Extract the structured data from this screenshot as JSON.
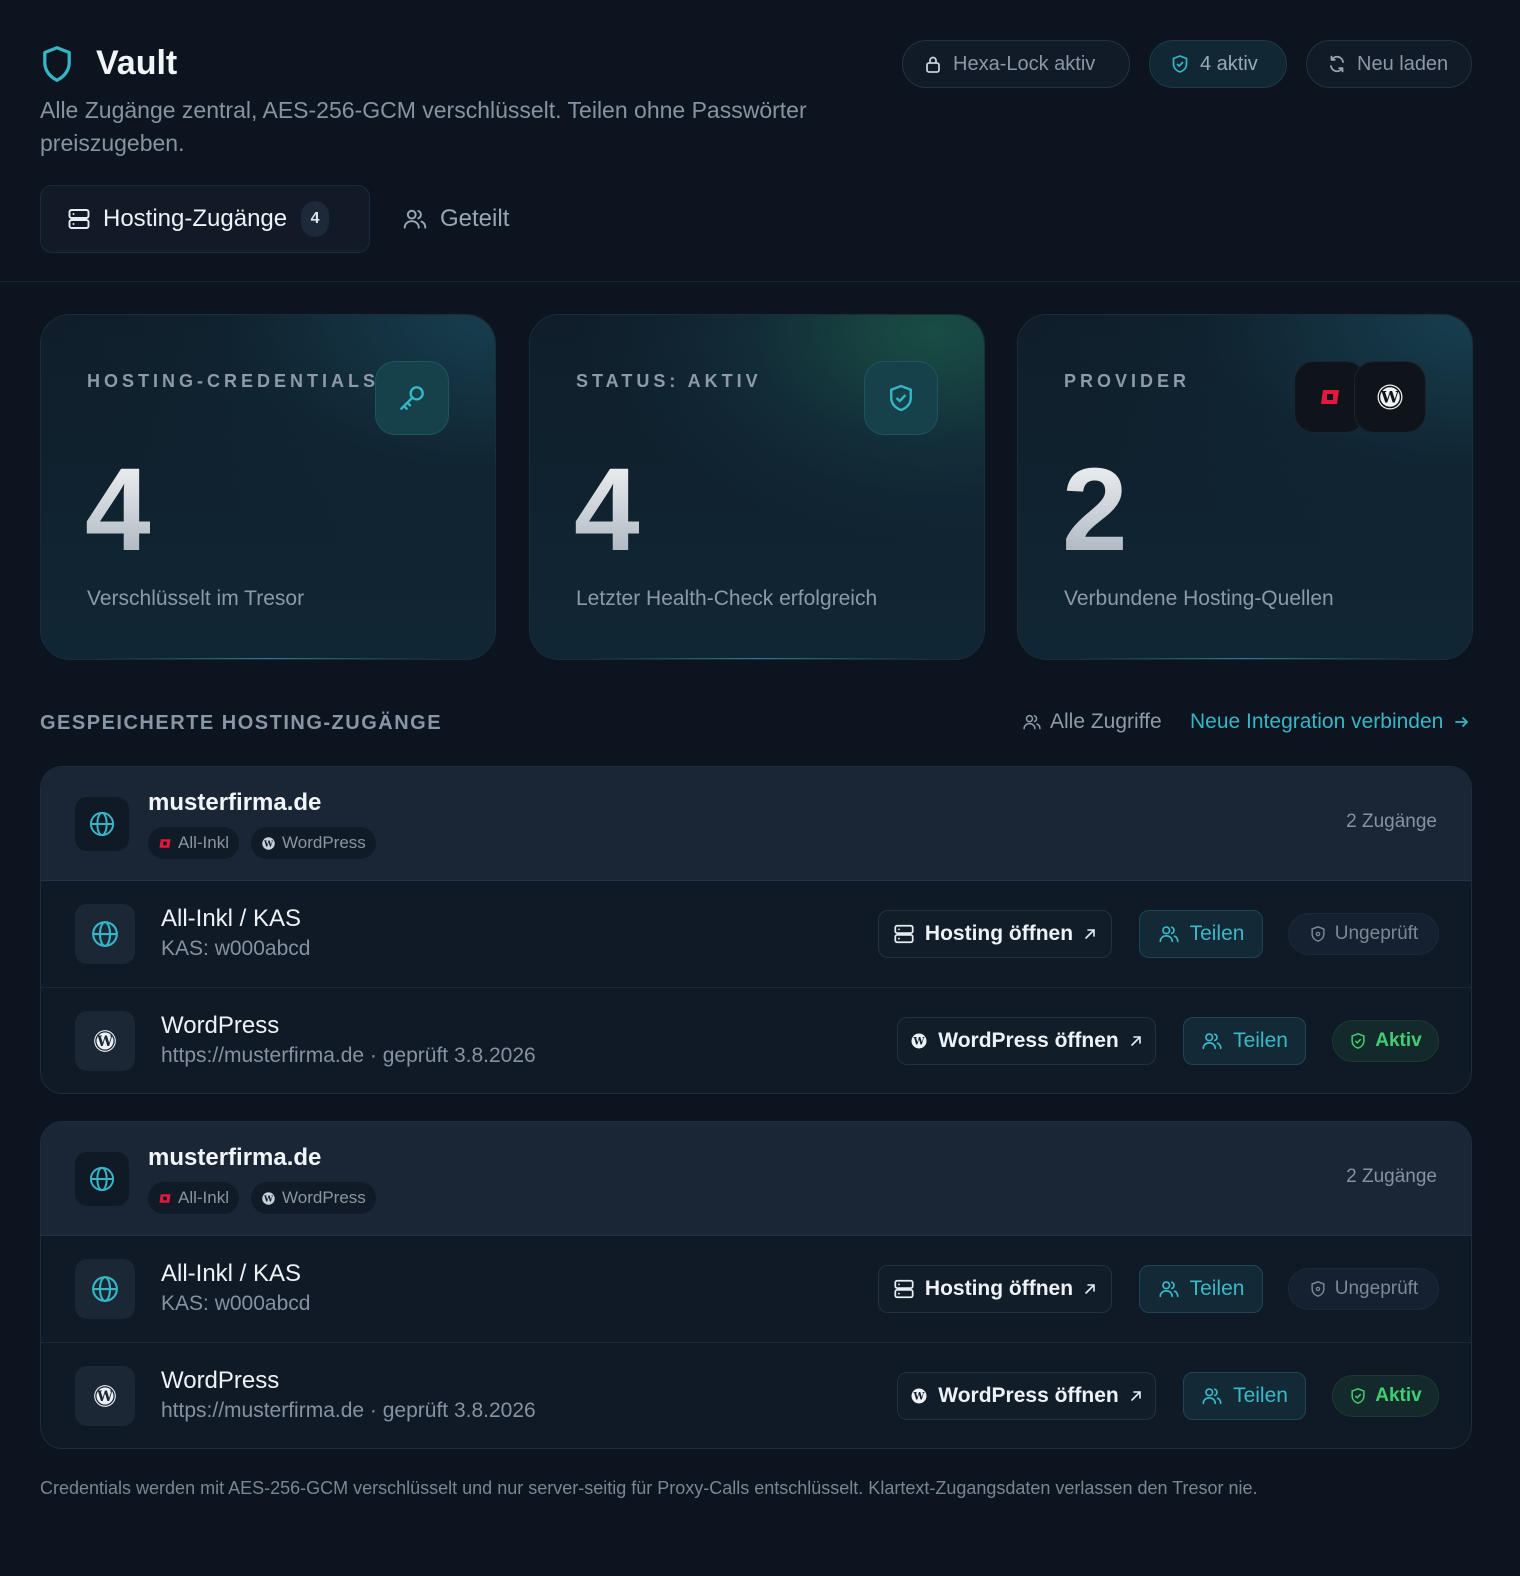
{
  "header": {
    "title": "Vault",
    "subtitle": "Alle Zugänge zentral, AES-256-GCM verschlüsselt. Teilen ohne Passwörter preiszugeben.",
    "hexa_lock_label": "Hexa-Lock aktiv",
    "active_label": "4 aktiv",
    "reload_label": "Neu laden"
  },
  "tabs": {
    "hosting_label": "Hosting-Zugänge",
    "hosting_count": "4",
    "shared_label": "Geteilt"
  },
  "stats": [
    {
      "label": "HOSTING-CREDENTIALS",
      "value": "4",
      "desc": "Verschlüsselt im Tresor"
    },
    {
      "label": "STATUS: AKTIV",
      "value": "4",
      "desc": "Letzter Health-Check erfolgreich"
    },
    {
      "label": "PROVIDER",
      "value": "2",
      "desc": "Verbundene Hosting-Quellen"
    }
  ],
  "section": {
    "title": "GESPEICHERTE HOSTING-ZUGÄNGE",
    "all_access_label": "Alle Zugriffe",
    "new_integration_label": "Neue Integration verbinden"
  },
  "groups": [
    {
      "domain": "musterfirma.de",
      "tags": [
        "All-Inkl",
        "WordPress"
      ],
      "count_label": "2 Zugänge",
      "rows": [
        {
          "title": "All-Inkl / KAS",
          "sub": "KAS: w000abcd",
          "open_label": "Hosting öffnen",
          "share_label": "Teilen",
          "status": "Ungeprüft"
        },
        {
          "title": "WordPress",
          "sub": "https://musterfirma.de · geprüft 3.8.2026",
          "open_label": "WordPress öffnen",
          "share_label": "Teilen",
          "status": "Aktiv"
        }
      ]
    },
    {
      "domain": "musterfirma.de",
      "tags": [
        "All-Inkl",
        "WordPress"
      ],
      "count_label": "2 Zugänge",
      "rows": [
        {
          "title": "All-Inkl / KAS",
          "sub": "KAS: w000abcd",
          "open_label": "Hosting öffnen",
          "share_label": "Teilen",
          "status": "Ungeprüft"
        },
        {
          "title": "WordPress",
          "sub": "https://musterfirma.de · geprüft 3.8.2026",
          "open_label": "WordPress öffnen",
          "share_label": "Teilen",
          "status": "Aktiv"
        }
      ]
    }
  ],
  "footer": {
    "text": "Credentials werden mit AES-256-GCM verschlüsselt und nur server-seitig für Proxy-Calls entschlüsselt. Klartext-Zugangsdaten verlassen den Tresor nie."
  },
  "icons": {
    "brand": "shield-icon",
    "lock": "lock-icon",
    "reload": "refresh-icon",
    "server": "server-icon",
    "users": "users-icon",
    "key": "key-icon",
    "globe": "globe-icon",
    "wordpress": "wordpress-icon",
    "allinkl": "allinkl-icon",
    "arrow": "arrow-up-right-icon"
  },
  "colors": {
    "background": "#0c1420",
    "accent": "#35b6c6",
    "success": "#3fcf72",
    "allinkl_red": "#e3183c"
  }
}
